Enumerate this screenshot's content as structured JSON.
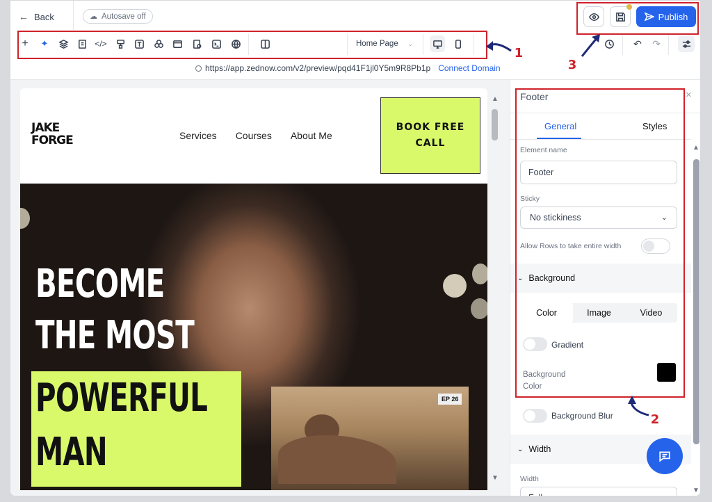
{
  "header": {
    "back_label": "Back",
    "autosave_label": "Autosave off",
    "publish_label": "Publish"
  },
  "toolbar": {
    "page_select": "Home Page"
  },
  "url_bar": {
    "url": "https://app.zednow.com/v2/preview/pqd41F1jl0Y5m9R8Pb1p",
    "connect_label": "Connect Domain"
  },
  "annotations": {
    "one": "1",
    "two": "2",
    "three": "3"
  },
  "site": {
    "logo_line1": "JAKE",
    "logo_line2": "FORGE",
    "nav": [
      "Services",
      "Courses",
      "About Me"
    ],
    "cta_line1": "BOOK FREE",
    "cta_line2": "CALL",
    "hero_line1": "BECOME",
    "hero_line2": "THE MOST",
    "hero_line3": "POWERFUL",
    "hero_line4": "MAN",
    "episode_badge": "EP 26"
  },
  "panel": {
    "title": "Footer",
    "tabs": [
      "General",
      "Styles"
    ],
    "element_name_label": "Element name",
    "element_name_value": "Footer",
    "sticky_label": "Sticky",
    "sticky_value": "No stickiness",
    "allow_rows_label": "Allow Rows to take entire width",
    "background_section": "Background",
    "bg_tabs": [
      "Color",
      "Image",
      "Video"
    ],
    "gradient_label": "Gradient",
    "bg_color_label_1": "Background",
    "bg_color_label_2": "Color",
    "bg_blur_label": "Background Blur",
    "width_section": "Width",
    "width_label": "Width",
    "width_value": "Full"
  },
  "colors": {
    "accent": "#2563eb",
    "lime": "#d9f96b",
    "annotation_red": "#d0222a",
    "annotation_navy": "#1e2a78",
    "swatch": "#000000"
  }
}
